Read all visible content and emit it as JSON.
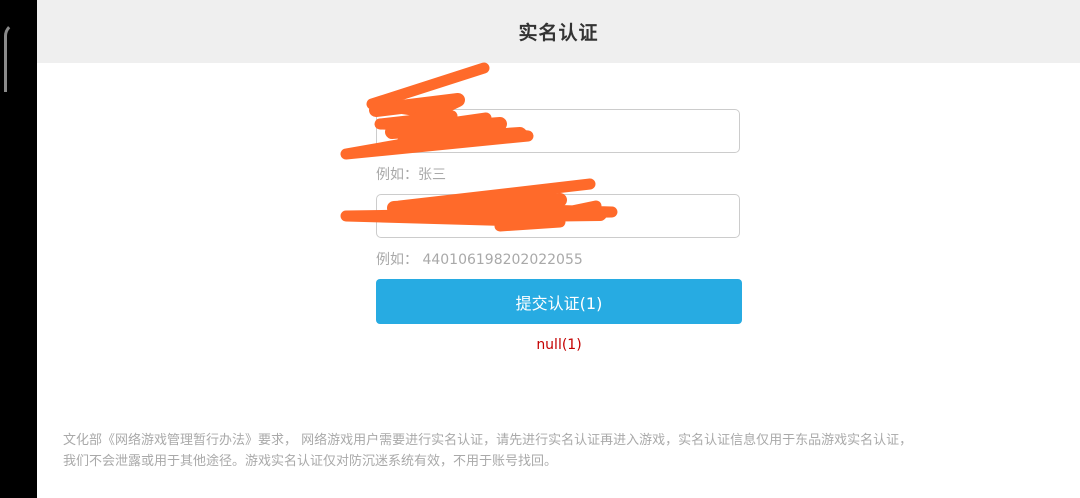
{
  "header": {
    "title": "实名认证"
  },
  "form": {
    "name_field": {
      "value": "",
      "hint": "例如：张三"
    },
    "id_field": {
      "value": "",
      "hint": "例如： 440106198202022055"
    },
    "submit_label": "提交认证(1)",
    "status": "null(1)"
  },
  "notice": {
    "line1": "文化部《网络游戏管理暂行办法》要求， 网络游戏用户需要进行实名认证，请先进行实名认证再进入游戏，实名认证信息仅用于东品游戏实名认证，",
    "line2": "我们不会泄露或用于其他途径。游戏实名认证仅对防沉迷系统有效，不用于账号找回。"
  },
  "colors": {
    "header_bg": "#efefef",
    "submit_bg": "#27abe2",
    "status_text": "#c40000",
    "redaction": "#ff6a2a"
  }
}
